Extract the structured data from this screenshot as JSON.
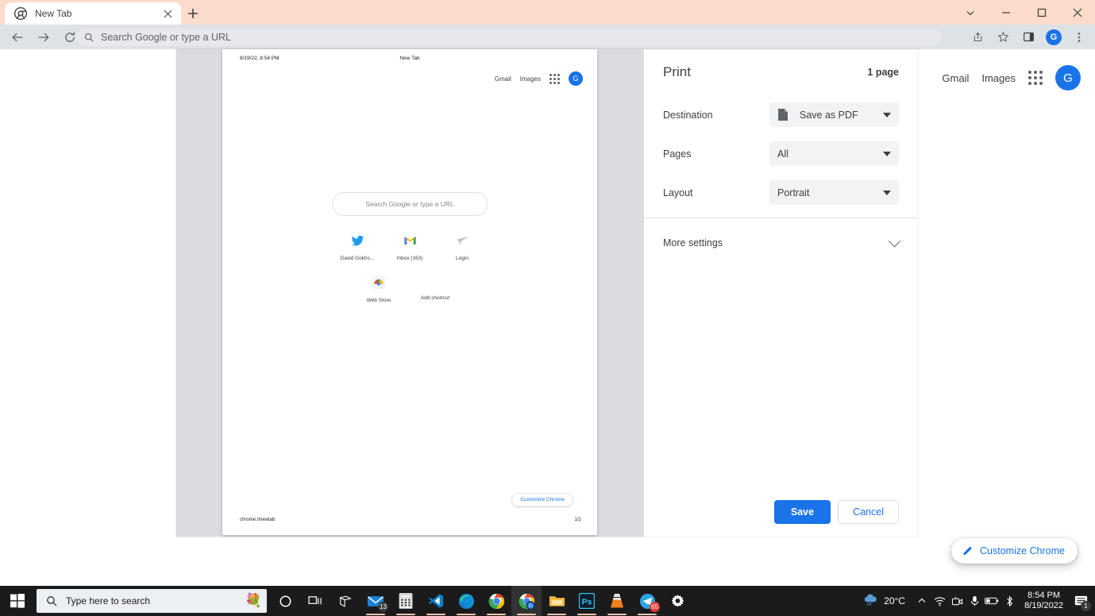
{
  "browser": {
    "tab": {
      "title": "New Tab",
      "favicon": "chrome-favicon",
      "close_icon": "close-icon"
    },
    "new_tab_button": "+",
    "window_controls": {
      "minimize_panel": "chevron-down-icon",
      "minimize": "minimize-icon",
      "maximize": "maximize-icon",
      "close": "close-icon"
    },
    "nav": {
      "back": "back-arrow-icon",
      "forward": "forward-arrow-icon",
      "reload": "reload-icon"
    },
    "omnibox": {
      "placeholder": "Search Google or type a URL",
      "value": "",
      "icon": "search-icon"
    },
    "toolbar_right": {
      "share_icon": "share-icon",
      "bookmark_icon": "star-icon",
      "sidepanel_icon": "side-panel-icon",
      "profile_initial": "G",
      "menu_icon": "three-dot-menu-icon"
    },
    "accent_color": "#1a73e8",
    "titlebar_color": "#fbdccb"
  },
  "newtab_page": {
    "links": [
      "Gmail",
      "Images"
    ],
    "apps_icon": "apps-grid-icon",
    "profile_initial": "G",
    "customize_button": {
      "label": "Customize Chrome",
      "icon": "pencil-icon"
    }
  },
  "print_preview": {
    "document": {
      "header_date": "8/19/22, 8:54 PM",
      "header_title": "New Tab",
      "links": [
        "Gmail",
        "Images"
      ],
      "apps_icon": "apps-grid-icon",
      "profile_initial": "G",
      "search_placeholder": "Search Google or type a URL",
      "shortcuts": [
        {
          "label": "David Gokhs...",
          "icon": "twitter-icon"
        },
        {
          "label": "Inbox (163)",
          "icon": "gmail-icon"
        },
        {
          "label": "Login",
          "icon": "paper-plane-icon"
        }
      ],
      "shortcuts_row2": [
        {
          "label": "Web Store",
          "icon": "chrome-webstore-icon"
        },
        {
          "label": "Add shortcut",
          "icon": ""
        }
      ],
      "customize_button": {
        "label": "Customize Chrome"
      },
      "footer_url": "chrome://newtab",
      "footer_page": "1/1"
    }
  },
  "print_dialog": {
    "title": "Print",
    "page_count": "1 page",
    "settings": [
      {
        "label": "Destination",
        "value": "Save as PDF",
        "icon": "pdf-document-icon",
        "caret": "chevron-down-icon"
      },
      {
        "label": "Pages",
        "value": "All",
        "icon": "",
        "caret": "chevron-down-icon"
      },
      {
        "label": "Layout",
        "value": "Portrait",
        "icon": "",
        "caret": "chevron-down-icon"
      }
    ],
    "more_settings": {
      "label": "More settings",
      "icon": "chevron-down-icon"
    },
    "save_label": "Save",
    "cancel_label": "Cancel"
  },
  "taskbar": {
    "start_icon": "windows-start-icon",
    "search": {
      "placeholder": "Type here to search",
      "icon": "search-icon",
      "emoji": "💐"
    },
    "apps": [
      {
        "name": "cortana-icon",
        "badge": ""
      },
      {
        "name": "task-view-icon",
        "badge": ""
      },
      {
        "name": "widgets-icon",
        "badge": ""
      },
      {
        "name": "mail-icon",
        "badge": "13"
      },
      {
        "name": "calculator-icon",
        "badge": ""
      },
      {
        "name": "vscode-icon",
        "badge": ""
      },
      {
        "name": "edge-icon",
        "badge": ""
      },
      {
        "name": "chrome-icon",
        "badge": ""
      },
      {
        "name": "chrome-profile-icon",
        "badge": ""
      },
      {
        "name": "file-explorer-icon",
        "badge": ""
      },
      {
        "name": "photoshop-icon",
        "badge": "Ps"
      },
      {
        "name": "vlc-icon",
        "badge": ""
      },
      {
        "name": "telegram-icon",
        "badge": "65"
      },
      {
        "name": "settings-gear-icon",
        "badge": ""
      }
    ],
    "tray": {
      "weather_temp": "20°C",
      "weather_icon": "cloud-rain-icon",
      "chevron_icon": "chevron-up-icon",
      "icons": [
        "wifi-icon",
        "camera-icon",
        "microphone-icon",
        "battery-icon",
        "bluetooth-icon"
      ],
      "time": "8:54 PM",
      "date": "8/19/2022",
      "notification_badge": "1",
      "notification_icon": "notification-icon"
    }
  }
}
